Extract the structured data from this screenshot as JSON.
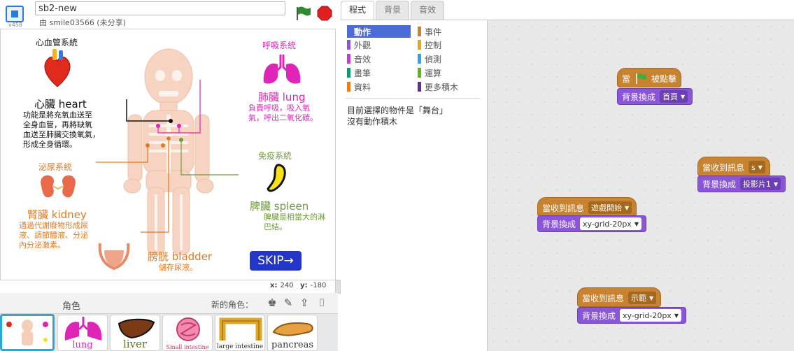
{
  "header": {
    "version": "v458",
    "project_title": "sb2-new",
    "byline": "由 smile03566 (未分享)"
  },
  "stage": {
    "labels": {
      "cardio_system": "心血管系統",
      "heart_title": "心臟 heart",
      "heart_desc": [
        "功能是將充氧血送至",
        "全身血管，再將缺氧",
        "血送至肺臟交換氧氣，",
        "形成全身循環。"
      ],
      "resp_system": "呼吸系統",
      "lung_title": "肺臟 lung",
      "lung_desc": [
        "負責呼吸，吸入氧",
        "氣，呼出二氧化碳。"
      ],
      "immune_system": "免疫系統",
      "spleen_title": "脾臟 spleen",
      "spleen_desc": [
        "脾臟是相當大的淋",
        "巴結。"
      ],
      "urinary_system": "泌尿系統",
      "kidney_title": "腎臟 kidney",
      "kidney_desc": [
        "通過代謝廢物形成尿",
        "液、調節體液、分泌",
        "內分泌激素。"
      ],
      "bladder_title": "膀胱 bladder",
      "bladder_desc": "儲存尿液。",
      "skip": "SKIP→"
    },
    "coords": {
      "x_label": "x:",
      "x": "240",
      "y_label": "y:",
      "y": "-180"
    }
  },
  "sprites": {
    "label": "角色",
    "new_sprite_label": "新的角色：",
    "tools": [
      "character-icon",
      "paint-brush-icon",
      "upload-icon",
      "camera-icon"
    ],
    "items": [
      {
        "name": "lung"
      },
      {
        "name": "liver"
      },
      {
        "name": "Small intestine"
      },
      {
        "name": "large intestine"
      },
      {
        "name": "pancreas"
      }
    ]
  },
  "tabs": [
    {
      "label": "程式",
      "active": true
    },
    {
      "label": "背景",
      "active": false
    },
    {
      "label": "音效",
      "active": false
    }
  ],
  "palette": {
    "categories": [
      {
        "label": "動作",
        "color": "#4a6cd4",
        "selected": true
      },
      {
        "label": "外觀",
        "color": "#8a55d7",
        "selected": false
      },
      {
        "label": "音效",
        "color": "#bb42c3",
        "selected": false
      },
      {
        "label": "畫筆",
        "color": "#0e9a6c",
        "selected": false
      },
      {
        "label": "資料",
        "color": "#ee7d16",
        "selected": false
      },
      {
        "label": "事件",
        "color": "#c88330",
        "selected": false
      },
      {
        "label": "控制",
        "color": "#e1a91a",
        "selected": false
      },
      {
        "label": "偵測",
        "color": "#2ca5e2",
        "selected": false
      },
      {
        "label": "運算",
        "color": "#5cb712",
        "selected": false
      },
      {
        "label": "更多積木",
        "color": "#632d99",
        "selected": false
      }
    ],
    "selection_info": [
      "目前選擇的物件是「舞台」",
      "沒有動作積木"
    ]
  },
  "scripts": {
    "s1": {
      "hat_prefix": "當",
      "hat_suffix": "被點擊",
      "cmd": "背景換成",
      "value": "首頁"
    },
    "s2": {
      "hat": "當收到訊息",
      "msg": "s",
      "cmd": "背景換成",
      "value": "投影片1"
    },
    "s3": {
      "hat": "當收到訊息",
      "msg": "遊戲開始",
      "cmd": "背景換成",
      "value": "xy-grid-20px"
    },
    "s4": {
      "hat": "當收到訊息",
      "msg": "示範",
      "cmd": "背景換成",
      "value": "xy-grid-20px"
    }
  },
  "colors": {
    "event": "#c88330",
    "looks": "#8a55d7",
    "accent_blue": "#2a7bd4",
    "skip_button": "#2436c8",
    "flag_green": "#2e8b2e",
    "stop_red": "#e02020"
  }
}
